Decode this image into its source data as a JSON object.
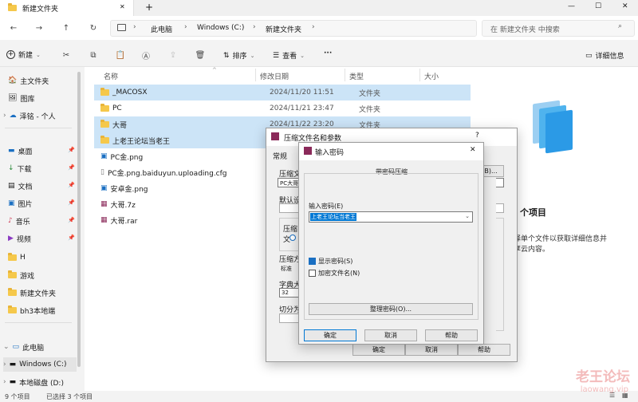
{
  "tab": {
    "title": "新建文件夹",
    "add": "+",
    "close": "✕"
  },
  "window_controls": {
    "min": "—",
    "max": "☐",
    "close": "✕"
  },
  "address": {
    "crumbs": [
      "此电脑",
      "Windows (C:)",
      "新建文件夹"
    ],
    "search_placeholder": "在 新建文件夹 中搜索"
  },
  "toolbar": {
    "new_label": "新建",
    "sort_label": "排序",
    "view_label": "查看",
    "more": "···",
    "details_label": "详细信息"
  },
  "nav": {
    "items": [
      {
        "label": "主文件夹",
        "icon": "home-icon"
      },
      {
        "label": "图库",
        "icon": "gallery-icon"
      },
      {
        "label": "泽铭 - 个人",
        "icon": "cloud-icon"
      },
      {
        "label": "桌面",
        "icon": "desktop-icon"
      },
      {
        "label": "下载",
        "icon": "download-icon"
      },
      {
        "label": "文档",
        "icon": "document-icon"
      },
      {
        "label": "图片",
        "icon": "picture-icon"
      },
      {
        "label": "音乐",
        "icon": "music-icon"
      },
      {
        "label": "视频",
        "icon": "video-icon"
      },
      {
        "label": "H",
        "icon": "folder-icon"
      },
      {
        "label": "游戏",
        "icon": "folder-icon"
      },
      {
        "label": "新建文件夹",
        "icon": "folder-icon"
      },
      {
        "label": "bh3本地端",
        "icon": "folder-icon"
      },
      {
        "label": "此电脑",
        "icon": "pc-icon"
      },
      {
        "label": "Windows (C:)",
        "icon": "drive-icon"
      },
      {
        "label": "本地磁盘 (D:)",
        "icon": "drive-icon"
      }
    ]
  },
  "list": {
    "headers": {
      "name": "名称",
      "date": "修改日期",
      "type": "类型",
      "size": "大小"
    },
    "rows": [
      {
        "name": "_MACOSX",
        "date": "2024/11/20 11:51",
        "type": "文件夹"
      },
      {
        "name": "PC",
        "date": "2024/11/21 23:47",
        "type": "文件夹"
      },
      {
        "name": "大哥",
        "date": "2024/11/22 23:20",
        "type": "文件夹"
      },
      {
        "name": "上老王论坛当老王",
        "date": "20",
        "type": ""
      },
      {
        "name": "PC金.png",
        "date": "20",
        "type": ""
      },
      {
        "name": "PC金.png.baiduyun.uploading.cfg",
        "date": "20",
        "type": ""
      },
      {
        "name": "安卓金.png",
        "date": "20",
        "type": ""
      },
      {
        "name": "大哥.7z",
        "date": "20",
        "type": ""
      },
      {
        "name": "大哥.rar",
        "date": "20",
        "type": ""
      }
    ]
  },
  "details": {
    "heading": "个项目",
    "line1": "择单个文件以获取详细信息并",
    "line2": "享云内容。"
  },
  "status": {
    "count": "9 个项目",
    "selected": "已选择 3 个项目"
  },
  "archive_dialog": {
    "title": "压缩文件名和参数",
    "help": "?",
    "tab1": "常规",
    "name_label": "压缩文",
    "name_value": "PC大哥",
    "browse": "(B)...",
    "default_label": "默认设",
    "format_label": "压缩文",
    "method_label": "压缩方",
    "method_value": "标准",
    "dict_label": "字典大小",
    "dict_value": "32",
    "split_label": "切分为",
    "ok": "确定",
    "cancel": "取消",
    "help_btn": "帮助"
  },
  "password_dialog": {
    "title": "输入密码",
    "close": "✕",
    "group_label": "带密码压缩",
    "input_label": "输入密码(E)",
    "input_value": "上老王论坛当老王",
    "show_pw": "显示密码(S)",
    "encrypt_names": "加密文件名(N)",
    "manage": "整理密码(O)...",
    "ok": "确定",
    "cancel": "取消",
    "help": "帮助"
  },
  "watermark": {
    "line1": "老王论坛",
    "line2": "laowang.vip"
  }
}
